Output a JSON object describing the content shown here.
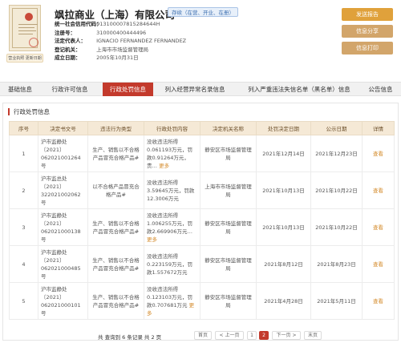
{
  "license": {
    "caption": "营业执照 更新日期"
  },
  "company": {
    "name": "飒拉商业（上海）有限公司",
    "status": "存续（在营、开业、在册）"
  },
  "info": [
    {
      "key": "统一社会信用代码：",
      "value": "913100007815284644H"
    },
    {
      "key": "注册号：",
      "value": "310000400444496"
    },
    {
      "key": "法定代表人：",
      "value": "IGNACIO FERNANDEZ FERNANDEZ"
    },
    {
      "key": "登记机关：",
      "value": "上海市市场监督管理局"
    },
    {
      "key": "成立日期：",
      "value": "2005年10月31日"
    }
  ],
  "actions": {
    "report": "发送报告",
    "share": "信息分享",
    "print": "信息打印"
  },
  "tabs": [
    {
      "label": "基础信息"
    },
    {
      "label": "行政许可信息"
    },
    {
      "label": "行政处罚信息"
    },
    {
      "label": "列入经营异常名录信息"
    },
    {
      "label": "列入严重违法失信名单（黑名单）信息"
    },
    {
      "label": "公告信息"
    }
  ],
  "section": {
    "title": "行政处罚信息"
  },
  "table": {
    "headers": [
      "序号",
      "决定书文号",
      "违法行为类型",
      "行政处罚内容",
      "决定机关名称",
      "处罚决定日期",
      "公示日期",
      "详情"
    ],
    "rows": [
      {
        "no": "1",
        "doc": "沪市监静处〔2021〕062021001264号",
        "type": "生产、销售以不合格产品冒充合格产品#",
        "content": "没收违法所得0.061193万元，罚款0.91264万元，责…",
        "more": "更多",
        "authority": "静安区市场监督管理局",
        "decision_date": "2021年12月14日",
        "publish_date": "2021年12月23日",
        "detail": "查看"
      },
      {
        "no": "2",
        "doc": "沪市监总处〔2021〕322021002062号",
        "type": "以不合格产品冒充合格产品#",
        "content": "没收违法所得3.59645万元，罚款12.3006万元",
        "more": "",
        "authority": "上海市市场监督管理局",
        "decision_date": "2021年10月13日",
        "publish_date": "2021年10月22日",
        "detail": "查看"
      },
      {
        "no": "3",
        "doc": "沪市监静处〔2021〕062021000138号",
        "type": "生产、销售以不合格产品冒充合格产品#",
        "content": "没收违法所得1.006255万元，罚款2.669906万元…",
        "more": "更多",
        "authority": "静安区市场监督管理局",
        "decision_date": "2021年10月13日",
        "publish_date": "2021年10月22日",
        "detail": "查看"
      },
      {
        "no": "4",
        "doc": "沪市监静处〔2021〕062021000485号",
        "type": "生产、销售以不合格产品冒充合格产品#",
        "content": "没收违法所得0.223159万元，罚款1.557672万元",
        "more": "",
        "authority": "静安区市场监督管理局",
        "decision_date": "2021年8月12日",
        "publish_date": "2021年8月23日",
        "detail": "查看"
      },
      {
        "no": "5",
        "doc": "沪市监静处〔2021〕062021000101号",
        "type": "生产、销售以不合格产品冒充合格产品#",
        "content": "没收违法所得0.123103万元，罚款0.707681万元",
        "more": "更多",
        "authority": "静安区市场监督管理局",
        "decision_date": "2021年4月28日",
        "publish_date": "2021年5月11日",
        "detail": "查看"
      }
    ]
  },
  "pagination": {
    "total": "共 查询到 6 条记录 共 2 页",
    "first": "首页",
    "prev": "< 上一页",
    "page1": "1",
    "page2": "2",
    "next": "下一页 >",
    "last": "末页"
  },
  "colors": {
    "accent": "#c33a2c",
    "report_button": "#e0a13b",
    "action_button": "#d2a56a",
    "table_header": "#f5e9d6",
    "link": "#d48a2a"
  }
}
